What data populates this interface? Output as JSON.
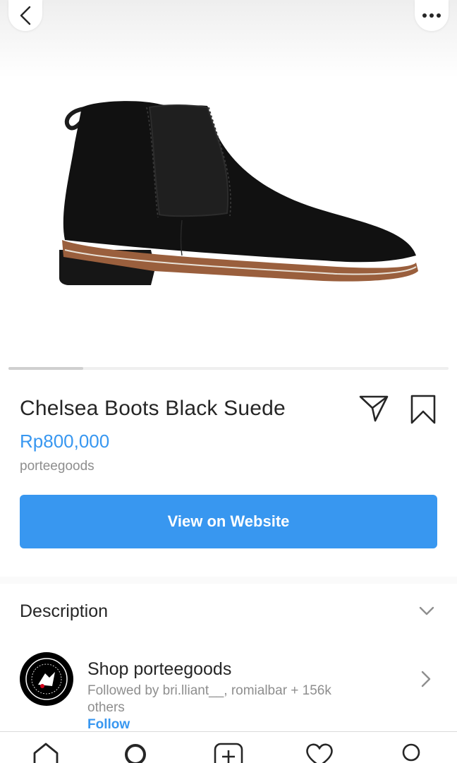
{
  "product": {
    "title": "Chelsea Boots Black Suede",
    "price": "Rp800,000",
    "seller": "porteegoods",
    "cta_label": "View on Website",
    "image_carousel_progress": 0.17
  },
  "description": {
    "label": "Description"
  },
  "shop": {
    "name": "Shop porteegoods",
    "followed_by": "Followed by bri.lliant__, romialbar + 156k others",
    "follow_label": "Follow"
  },
  "colors": {
    "accent": "#3897f0",
    "text": "#262626",
    "secondary_text": "#8e8e8e"
  },
  "icons": {
    "back": "chevron-left-icon",
    "more": "more-horizontal-icon",
    "share": "direct-share-icon",
    "save": "bookmark-icon",
    "expand": "chevron-down-icon",
    "shop_arrow": "chevron-right-icon",
    "tabs": [
      "home-icon",
      "search-icon",
      "add-post-icon",
      "activity-heart-icon",
      "profile-icon"
    ]
  }
}
